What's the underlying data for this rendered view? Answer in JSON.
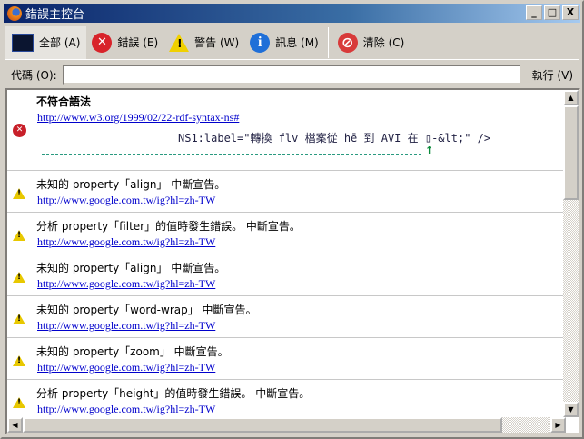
{
  "window": {
    "title": "錯誤主控台",
    "min": "_",
    "max": "□",
    "close": "X"
  },
  "toolbar": {
    "all": "全部 (A)",
    "errors": "錯誤 (E)",
    "warnings": "警告 (W)",
    "messages": "訊息 (M)",
    "clear": "清除 (C)"
  },
  "code": {
    "label": "代碼 (O):",
    "value": "",
    "evaluate": "執行 (V)"
  },
  "error_entry": {
    "message": "不符合語法",
    "link": "http://www.w3.org/1999/02/22-rdf-syntax-ns#",
    "source": "NS1:label=\"轉換 flv 檔案從 hē 到 AVI 在 ▯-&lt;\" />",
    "caret": "↑"
  },
  "warnings": [
    {
      "message": "未知的 property「align」 中斷宣告。",
      "link": "http://www.google.com.tw/ig?hl=zh-TW"
    },
    {
      "message": "分析 property「filter」的值時發生錯誤。 中斷宣告。",
      "link": "http://www.google.com.tw/ig?hl=zh-TW"
    },
    {
      "message": "未知的 property「align」 中斷宣告。",
      "link": "http://www.google.com.tw/ig?hl=zh-TW"
    },
    {
      "message": "未知的 property「word-wrap」 中斷宣告。",
      "link": "http://www.google.com.tw/ig?hl=zh-TW"
    },
    {
      "message": "未知的 property「zoom」 中斷宣告。",
      "link": "http://www.google.com.tw/ig?hl=zh-TW"
    },
    {
      "message": "分析 property「height」的值時發生錯誤。 中斷宣告。",
      "link": "http://www.google.com.tw/ig?hl=zh-TW"
    }
  ]
}
